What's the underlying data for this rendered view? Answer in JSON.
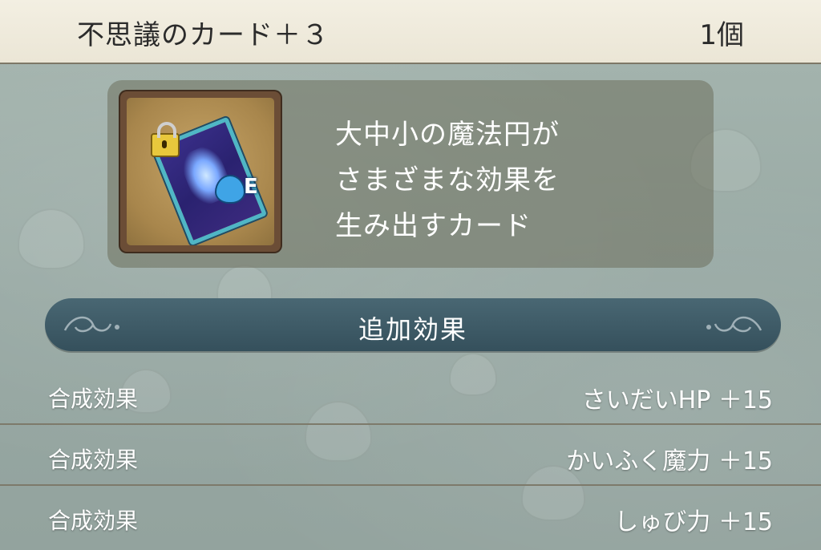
{
  "header": {
    "item_name": "不思議のカード＋３",
    "quantity": "1個"
  },
  "item": {
    "icon": "magic-card-icon",
    "rank_letter": "E",
    "description_lines": [
      "大中小の魔法円が",
      "さまざまな効果を",
      "生み出すカード"
    ]
  },
  "section": {
    "title": "追加効果"
  },
  "effects": [
    {
      "label": "合成効果",
      "value": "さいだいHP ＋15"
    },
    {
      "label": "合成効果",
      "value": "かいふく魔力 ＋15"
    },
    {
      "label": "合成効果",
      "value": "しゅび力 ＋15"
    }
  ],
  "colors": {
    "header_bg": "#efeadc",
    "section_bar": "#3e5a66",
    "panel_bg": "#6e705c",
    "card_border": "#4fb6c6"
  }
}
